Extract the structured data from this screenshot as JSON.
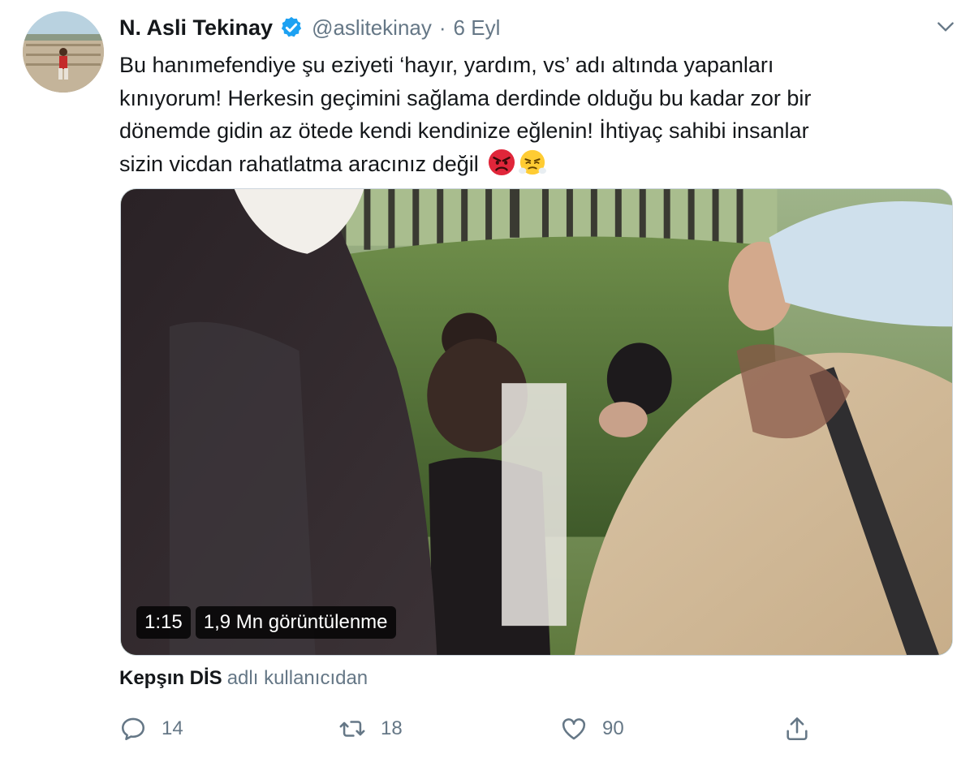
{
  "author": {
    "name": "N. Asli Tekinay",
    "handle": "@aslitekinay",
    "separator": "·",
    "date": "6 Eyl"
  },
  "tweet": {
    "lines": [
      "Bu hanımefendiye şu eziyeti ‘hayır, yardım, vs’ adı altında yapanları",
      "kınıyorum! Herkesin geçimini sağlama derdinde olduğu bu kadar zor bir",
      "dönemde gidin az ötede kendi kendinize eğlenin! İhtiyaç sahibi insanlar",
      "sizin vicdan rahatlatma aracınız değil"
    ],
    "emojis": [
      "angry-face-emoji",
      "face-with-steam-emoji"
    ]
  },
  "media": {
    "duration": "1:15",
    "views": "1,9 Mn görüntülenme"
  },
  "attribution": {
    "source_user": "Kepşın DİS",
    "suffix": "adlı kullanıcıdan"
  },
  "actions": {
    "replies": "14",
    "retweets": "18",
    "likes": "90"
  },
  "colors": {
    "verified": "#1da1f2",
    "secondary_text": "#657786",
    "primary_text": "#14171a"
  },
  "icons": [
    "verified-icon",
    "chevron-down-icon",
    "reply-icon",
    "retweet-icon",
    "like-icon",
    "share-icon"
  ]
}
